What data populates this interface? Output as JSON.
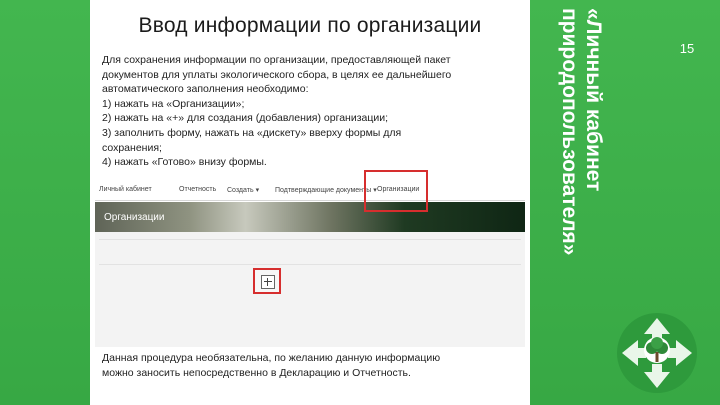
{
  "slide": {
    "title": "Ввод информации по организации",
    "page_number": "15",
    "vertical_caption_line1": "«Личный кабинет",
    "vertical_caption_line2": "природопользователя»",
    "intro_lines": [
      "Для сохранения информации по организации, предоставляющей пакет",
      "документов для уплаты экологического сбора, в целях ее дальнейшего",
      "автоматического заполнения необходимо:",
      "1) нажать на «Организации»;",
      "2) нажать на «+» для создания (добавления) организации;",
      "3) заполнить форму, нажать на «дискету» вверху формы для",
      "сохранения;",
      "4) нажать «Готово» внизу формы."
    ],
    "footer_lines": [
      "Данная процедура необязательна, по желанию данную информацию",
      "можно заносить непосредственно в Декларацию и Отчетность."
    ]
  },
  "screenshot": {
    "nav": {
      "items": [
        "Личный кабинет",
        "Отчетность",
        "Создать",
        "Подтверждающие документы",
        "Организации"
      ],
      "dropdown_marks": [
        "▾",
        "▾"
      ]
    },
    "banner_label": "Организации",
    "add_button_symbol": "+"
  },
  "colors": {
    "background_green": "#3cae4a",
    "highlight_red": "#d62e2e",
    "slide_white": "#ffffff"
  },
  "icons": {
    "logo": "recycle-tree-logo-icon",
    "add": "plus-square-icon"
  }
}
